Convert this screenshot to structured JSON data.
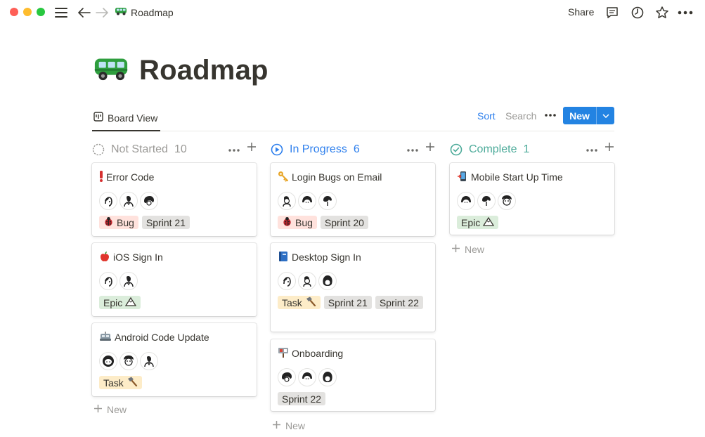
{
  "topbar": {
    "breadcrumb_icon": "bus-icon",
    "breadcrumb": "Roadmap",
    "share_label": "Share"
  },
  "page": {
    "title_icon": "bus-icon",
    "title": "Roadmap"
  },
  "viewbar": {
    "tab_label": "Board View",
    "sort_label": "Sort",
    "search_label": "Search",
    "new_label": "New"
  },
  "columns": [
    {
      "name": "Not Started",
      "count": "10",
      "color": "#9b9a97",
      "status_icon": "circle-dotted-icon",
      "new_label": "New",
      "cards": [
        {
          "icon": "exclamation-icon",
          "title": "Error Code",
          "avatars": 3,
          "tags": [
            {
              "label": "Bug",
              "kind": "bug",
              "icon": "ladybug-icon"
            },
            {
              "label": "Sprint 21",
              "kind": "sprint"
            }
          ]
        },
        {
          "icon": "apple-icon",
          "title": "iOS Sign In",
          "avatars": 2,
          "tags": [
            {
              "label": "Epic",
              "kind": "epic",
              "icon": "mountain-icon"
            }
          ]
        },
        {
          "icon": "robot-icon",
          "title": "Android Code Update",
          "avatars": 3,
          "tags": [
            {
              "label": "Task",
              "kind": "task",
              "icon": "hammer-icon"
            }
          ]
        }
      ]
    },
    {
      "name": "In Progress",
      "count": "6",
      "color": "#2f80ed",
      "status_icon": "play-circle-icon",
      "new_label": "New",
      "cards": [
        {
          "icon": "key-icon",
          "title": "Login Bugs on Email",
          "avatars": 3,
          "tags": [
            {
              "label": "Bug",
              "kind": "bug",
              "icon": "ladybug-icon"
            },
            {
              "label": "Sprint 20",
              "kind": "sprint"
            }
          ]
        },
        {
          "icon": "book-icon",
          "title": "Desktop Sign In",
          "avatars": 3,
          "tags": [
            {
              "label": "Task",
              "kind": "task",
              "icon": "hammer-icon"
            },
            {
              "label": "Sprint 21",
              "kind": "sprint"
            },
            {
              "label": "Sprint 22",
              "kind": "sprint"
            }
          ]
        },
        {
          "icon": "signpost-icon",
          "title": "Onboarding",
          "avatars": 3,
          "tags": [
            {
              "label": "Sprint 22",
              "kind": "sprint"
            }
          ]
        }
      ]
    },
    {
      "name": "Complete",
      "count": "1",
      "color": "#4dab9a",
      "status_icon": "check-circle-icon",
      "new_label": "New",
      "cards": [
        {
          "icon": "phone-icon",
          "title": "Mobile Start Up Time",
          "avatars": 3,
          "tags": [
            {
              "label": "Epic",
              "kind": "epic",
              "icon": "mountain-icon"
            }
          ]
        }
      ]
    }
  ]
}
